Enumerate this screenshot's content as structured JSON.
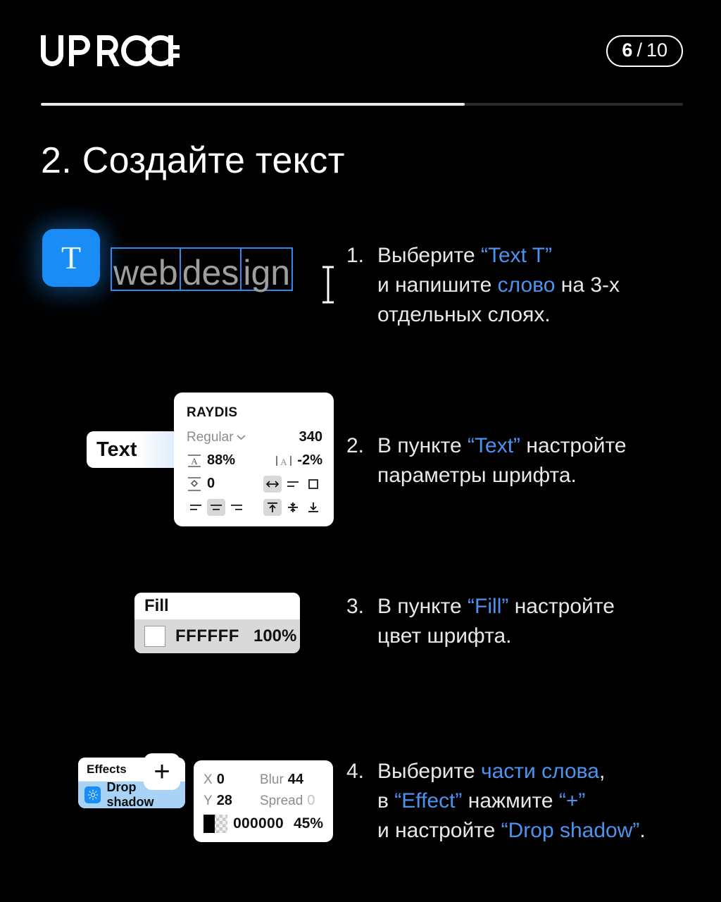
{
  "header": {
    "logo_text": "UPROCK",
    "logo_icon": "uprock-wordmark",
    "page_current": "6",
    "page_separator": "/",
    "page_total": "10"
  },
  "progress": {
    "percent": 66
  },
  "title": "2. Создайте текст",
  "steps": [
    {
      "number": "1.",
      "lines": [
        [
          {
            "t": "Выберите ",
            "hl": false
          },
          {
            "t": "“Text T”",
            "hl": true
          }
        ],
        [
          {
            "t": "и напишите ",
            "hl": false
          },
          {
            "t": "слово",
            "hl": true
          },
          {
            "t": " на 3-х",
            "hl": false
          }
        ],
        [
          {
            "t": "отдельных слоях.",
            "hl": false
          }
        ]
      ]
    },
    {
      "number": "2.",
      "lines": [
        [
          {
            "t": "В пункте ",
            "hl": false
          },
          {
            "t": "“Text”",
            "hl": true
          },
          {
            "t": " настройте",
            "hl": false
          }
        ],
        [
          {
            "t": "параметры шрифта.",
            "hl": false
          }
        ]
      ]
    },
    {
      "number": "3.",
      "lines": [
        [
          {
            "t": "В пункте ",
            "hl": false
          },
          {
            "t": "“Fill”",
            "hl": true
          },
          {
            "t": " настройте",
            "hl": false
          }
        ],
        [
          {
            "t": "цвет шрифта.",
            "hl": false
          }
        ]
      ]
    },
    {
      "number": "4.",
      "lines": [
        [
          {
            "t": "Выберите ",
            "hl": false
          },
          {
            "t": "части слова",
            "hl": true
          },
          {
            "t": ",",
            "hl": false
          }
        ],
        [
          {
            "t": "в ",
            "hl": false
          },
          {
            "t": "“Effect”",
            "hl": true
          },
          {
            "t": " нажмите ",
            "hl": false
          },
          {
            "t": "“+”",
            "hl": true
          }
        ],
        [
          {
            "t": "и настройте ",
            "hl": false
          },
          {
            "t": "“Drop shadow”",
            "hl": true
          },
          {
            "t": ".",
            "hl": false
          }
        ]
      ]
    }
  ],
  "text_tool": {
    "icon": "text-tool-T-icon",
    "glyph": "T",
    "word_boxes": [
      "web",
      "des",
      "ign"
    ],
    "cursor_icon": "i-beam-cursor-icon"
  },
  "text_chip": {
    "label": "Text"
  },
  "font_panel": {
    "family": "RAYDIS",
    "style": "Regular",
    "style_caret_icon": "chevron-down-icon",
    "size": "340",
    "line_height_icon": "line-height-icon",
    "line_height": "88%",
    "letter_spacing_icon": "letter-spacing-icon",
    "letter_spacing": "-2%",
    "paragraph_spacing_icon": "paragraph-spacing-icon",
    "paragraph_spacing": "0",
    "resize_icons": [
      "auto-width-icon",
      "auto-height-icon",
      "fixed-size-icon"
    ],
    "align_icons": [
      "align-left-icon",
      "align-center-icon",
      "align-right-icon"
    ],
    "valign_icons": [
      "align-top-icon",
      "align-middle-icon",
      "align-bottom-icon"
    ],
    "selected_resize": 0,
    "selected_align": 1,
    "selected_valign": 0
  },
  "fill_panel": {
    "title": "Fill",
    "swatch_icon": "color-swatch-white",
    "hex": "FFFFFF",
    "opacity": "100%"
  },
  "effects_panel": {
    "title": "Effects",
    "add_label": "+",
    "add_icon": "plus-icon",
    "effect_icon": "drop-shadow-icon",
    "effect_label": "Drop shadow"
  },
  "shadow_panel": {
    "x_label": "X",
    "x_value": "0",
    "blur_label": "Blur",
    "blur_value": "44",
    "y_label": "Y",
    "y_value": "28",
    "spread_label": "Spread",
    "spread_value": "0",
    "color_icon": "color-swatch-checkered-black",
    "hex": "000000",
    "opacity": "45%"
  },
  "colors": {
    "background": "#000000",
    "accent_blue": "#4d93ee",
    "tool_blue": "#1a8cf5",
    "text_white": "#e8e8e8",
    "word_grey": "#9e9e9e"
  }
}
